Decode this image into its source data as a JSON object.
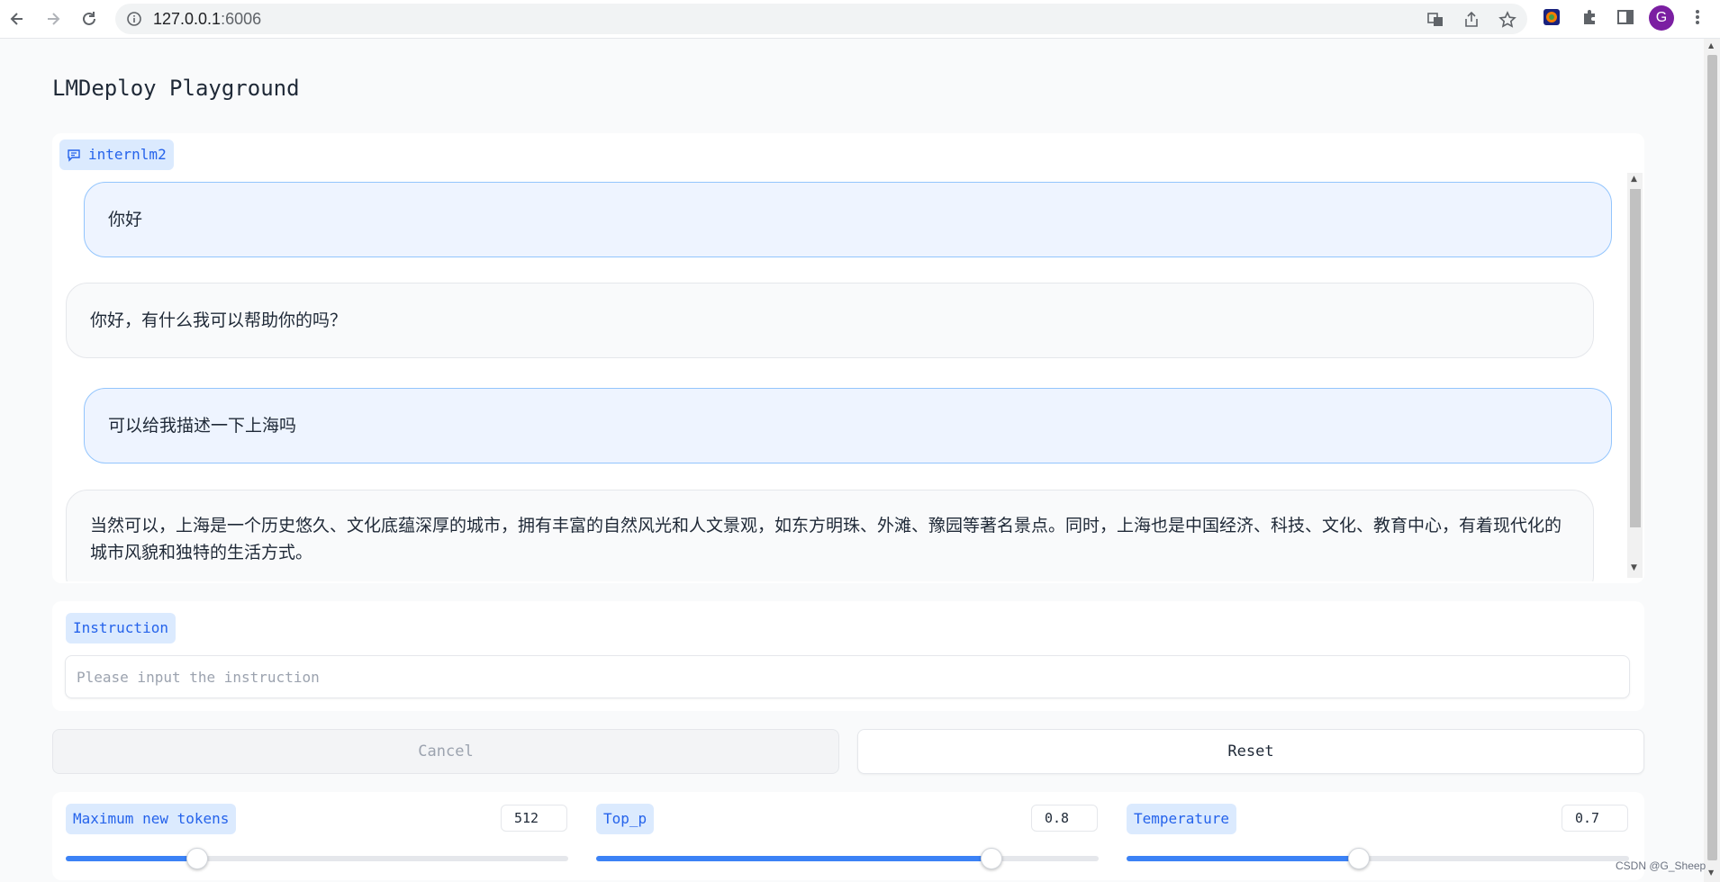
{
  "browser": {
    "url_host": "127.0.0.1",
    "url_port": ":6006",
    "profile_initial": "G"
  },
  "app": {
    "title": "LMDeploy Playground"
  },
  "chat": {
    "model_label": "internlm2",
    "messages": [
      {
        "role": "user",
        "text": "你好"
      },
      {
        "role": "assistant",
        "text": "你好，有什么我可以帮助你的吗？"
      },
      {
        "role": "user",
        "text": "可以给我描述一下上海吗"
      },
      {
        "role": "assistant",
        "text": "当然可以，上海是一个历史悠久、文化底蕴深厚的城市，拥有丰富的自然风光和人文景观，如东方明珠、外滩、豫园等著名景点。同时，上海也是中国经济、科技、文化、教育中心，有着现代化的城市风貌和独特的生活方式。"
      }
    ]
  },
  "instruction": {
    "label": "Instruction",
    "placeholder": "Please input the instruction",
    "value": ""
  },
  "buttons": {
    "cancel": "Cancel",
    "reset": "Reset"
  },
  "params": {
    "max_tokens": {
      "label": "Maximum new tokens",
      "value": "512",
      "fraction": 0.26
    },
    "top_p": {
      "label": "Top_p",
      "value": "0.8",
      "fraction": 0.785
    },
    "temperature": {
      "label": "Temperature",
      "value": "0.7",
      "fraction": 0.46
    }
  },
  "watermark": "CSDN @G_Sheep",
  "colors": {
    "accent": "#3b82f6",
    "chip_bg": "#dbeafe",
    "user_bubble": "#eef4ff",
    "avatar": "#7b1fa2"
  }
}
